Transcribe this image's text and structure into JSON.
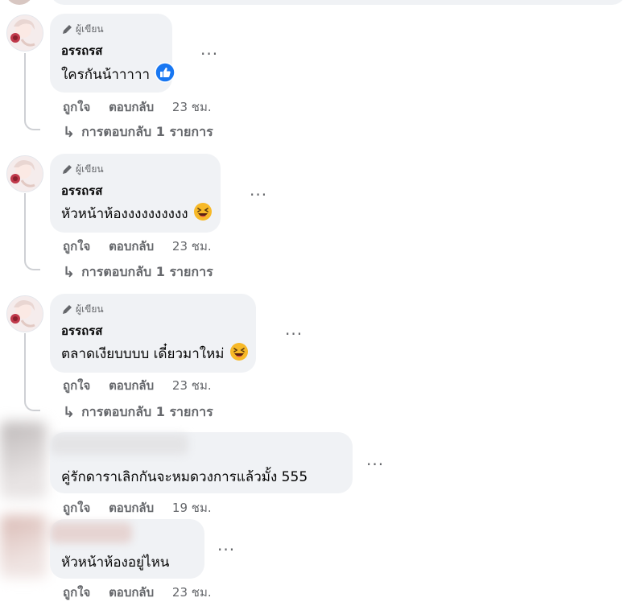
{
  "comments": [
    {
      "badge": "ผู้เขียน",
      "author": "อรรถรส",
      "text": "ใครกันน้าาาาา",
      "reaction_icon": "like-icon",
      "actions": {
        "like": "ถูกใจ",
        "reply": "ตอบกลับ",
        "time": "23 ชม."
      },
      "replies": "การตอบกลับ 1 รายการ"
    },
    {
      "badge": "ผู้เขียน",
      "author": "อรรถรส",
      "text": "หัวหน้าห้องงงงงงงงงง",
      "reaction_icon": "laughing-emoji-icon",
      "actions": {
        "like": "ถูกใจ",
        "reply": "ตอบกลับ",
        "time": "23 ชม."
      },
      "replies": "การตอบกลับ 1 รายการ"
    },
    {
      "badge": "ผู้เขียน",
      "author": "อรรถรส",
      "text": "ตลาดเงียบบบบ เดี๋ยวมาใหม่",
      "reaction_icon": "laughing-emoji-icon",
      "actions": {
        "like": "ถูกใจ",
        "reply": "ตอบกลับ",
        "time": "23 ชม."
      },
      "replies": "การตอบกลับ 1 รายการ"
    },
    {
      "text": "คู่รักดาราเลิกกันจะหมดวงการแล้วมั้ง 555",
      "actions": {
        "like": "ถูกใจ",
        "reply": "ตอบกลับ",
        "time": "19 ชม."
      }
    },
    {
      "text": "หัวหน้าห้องอยู่ไหน",
      "actions": {
        "like": "ถูกใจ",
        "reply": "ตอบกลับ",
        "time": "23 ชม."
      }
    }
  ],
  "more_label": "...",
  "colors": {
    "bubble": "#f0f2f5",
    "secondary_text": "#65676b",
    "like_blue": "#1877f2",
    "emoji_yellow": "#f7b928"
  }
}
